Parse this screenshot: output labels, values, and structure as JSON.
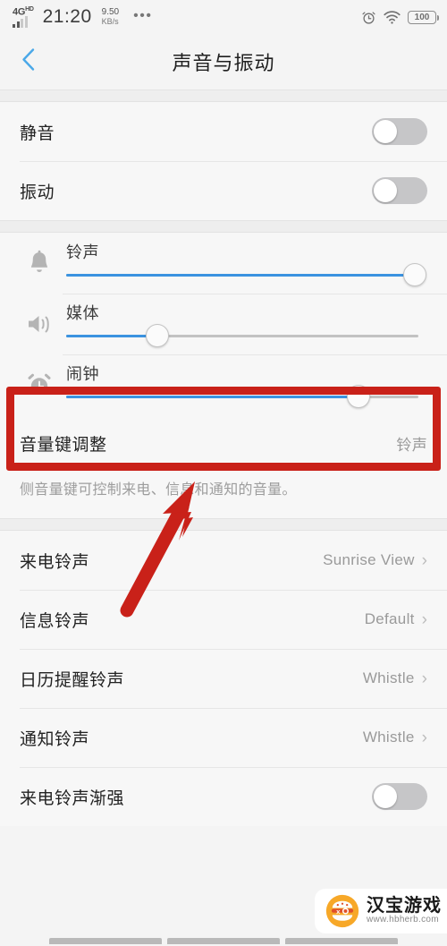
{
  "status_bar": {
    "network_label": "4G",
    "network_sup": "HD",
    "time": "21:20",
    "net_speed_value": "9.50",
    "net_speed_unit": "KB/s",
    "overflow_dots": "•••",
    "alarm_icon": "alarm-clock-icon",
    "wifi_icon": "wifi-icon",
    "battery_level": "100"
  },
  "header": {
    "back_icon": "chevron-left-icon",
    "title": "声音与振动",
    "accent_color": "#4aa8e8"
  },
  "toggles_section": [
    {
      "label": "静音",
      "state": "off"
    },
    {
      "label": "振动",
      "state": "off"
    }
  ],
  "sliders_section": [
    {
      "icon": "bell-icon",
      "label": "铃声",
      "percent": 99
    },
    {
      "icon": "speaker-icon",
      "label": "媒体",
      "percent": 26
    },
    {
      "icon": "alarm-clock-icon",
      "label": "闹钟",
      "percent": 83
    }
  ],
  "volume_key_row": {
    "label": "音量键调整",
    "value": "铃声",
    "description": "侧音量键可控制来电、信息和通知的音量。"
  },
  "ringtone_rows": [
    {
      "label": "来电铃声",
      "value": "Sunrise View",
      "chevron": "›"
    },
    {
      "label": "信息铃声",
      "value": "Default",
      "chevron": "›"
    },
    {
      "label": "日历提醒铃声",
      "value": "Whistle",
      "chevron": "›"
    },
    {
      "label": "通知铃声",
      "value": "Whistle",
      "chevron": "›"
    }
  ],
  "gradual_row": {
    "label": "来电铃声渐强",
    "state": "off"
  },
  "annotations": {
    "highlight_color": "#c92119",
    "highlight_target": "闹钟",
    "arrow_color": "#c92119"
  },
  "watermark": {
    "name": "汉宝游戏",
    "url": "www.hbherb.com",
    "logo_icon": "burger-logo-icon",
    "logo_color": "#f5a623"
  }
}
